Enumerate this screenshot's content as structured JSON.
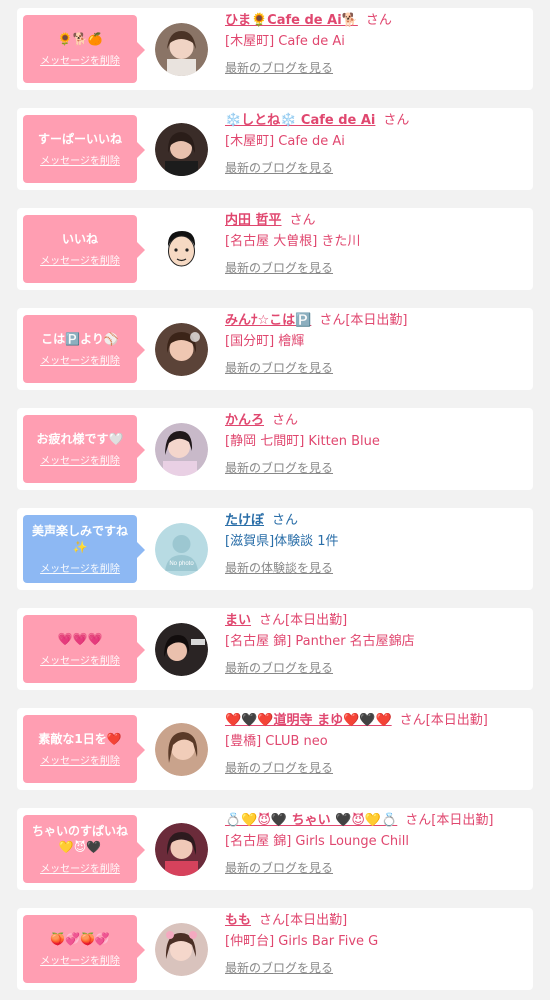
{
  "colors": {
    "pink_bubble": "#ff9eb2",
    "blue_bubble": "#8db8f3",
    "name_pink": "#e0476f",
    "name_blue": "#2a6ea8",
    "link_gray": "#888888",
    "background": "#f2f2f2"
  },
  "items": [
    {
      "message": "🌻🐕🍊",
      "delete_label": "メッセージを削除",
      "name": "ひま🌻Cafe de Ai🐕",
      "suffix": "さん",
      "status": "",
      "location": "[木屋町] Cafe de Ai",
      "link": "最新のブログを見る",
      "avatar": "girl-photo-avatar",
      "theme": "pink"
    },
    {
      "message": "すーぱーいいね",
      "delete_label": "メッセージを削除",
      "name": "❄️しとね❄️ Cafe de Ai",
      "suffix": "さん",
      "status": "",
      "location": "[木屋町] Cafe de Ai",
      "link": "最新のブログを見る",
      "avatar": "girl-photo-avatar",
      "theme": "pink"
    },
    {
      "message": "いいね",
      "delete_label": "メッセージを削除",
      "name": "内田 哲平",
      "suffix": "さん",
      "status": "",
      "location": "[名古屋 大曽根] きた川",
      "link": "最新のブログを見る",
      "avatar": "cartoon-man-avatar",
      "theme": "pink"
    },
    {
      "message": "こは🅿️より⚾",
      "delete_label": "メッセージを削除",
      "name": "みんﾅ☆こは🅿️",
      "suffix": "さん",
      "status": "[本日出勤]",
      "location": "[国分町] 檜輝",
      "link": "最新のブログを見る",
      "avatar": "girl-photo-avatar",
      "theme": "pink"
    },
    {
      "message": "お疲れ様です🤍",
      "delete_label": "メッセージを削除",
      "name": "かんろ",
      "suffix": "さん",
      "status": "",
      "location": "[静岡 七間町] Kitten Blue",
      "link": "最新のブログを見る",
      "avatar": "girl-photo-avatar",
      "theme": "pink"
    },
    {
      "message": "美声楽しみですね✨",
      "delete_label": "メッセージを削除",
      "name": "たけぼ",
      "suffix": "さん",
      "status": "",
      "location": "[滋賀県]体験談 1件",
      "link": "最新の体験談を見る",
      "avatar": "no-photo-avatar",
      "avatar_text": "No photo",
      "theme": "blue"
    },
    {
      "message": "💗💗💗",
      "delete_label": "メッセージを削除",
      "name": "まい",
      "suffix": "さん",
      "status": "[本日出勤]",
      "location": "[名古屋 錦] Panther 名古屋錦店",
      "link": "最新のブログを見る",
      "avatar": "girl-photo-avatar",
      "theme": "pink"
    },
    {
      "message": "素敵な1日を❤️",
      "delete_label": "メッセージを削除",
      "name": "❤️🖤❤️道明寺 まゆ❤️🖤❤️",
      "suffix": "さん",
      "status": "[本日出勤]",
      "location": "[豊橋] CLUB neo",
      "link": "最新のブログを見る",
      "avatar": "girl-photo-avatar",
      "theme": "pink"
    },
    {
      "message": "ちゃいのすぱいね💛😈🖤",
      "delete_label": "メッセージを削除",
      "name": "💍💛😈🖤 ちゃい 🖤😈💛💍",
      "suffix": "さん",
      "status": "[本日出勤]",
      "location": "[名古屋 錦] Girls Lounge Chill",
      "link": "最新のブログを見る",
      "avatar": "girl-photo-avatar",
      "theme": "pink"
    },
    {
      "message": "🍑💞🍑💞",
      "delete_label": "メッセージを削除",
      "name": "もも",
      "suffix": "さん",
      "status": "[本日出勤]",
      "location": "[仲町台] Girls Bar Five G",
      "link": "最新のブログを見る",
      "avatar": "girl-photo-avatar",
      "theme": "pink"
    }
  ]
}
